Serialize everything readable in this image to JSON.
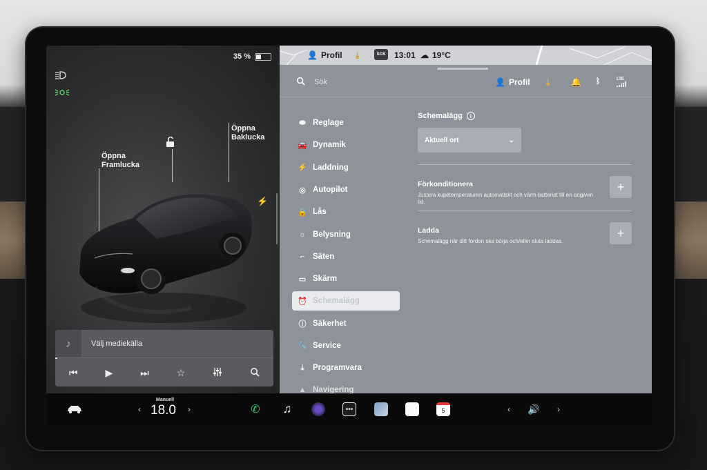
{
  "status": {
    "battery_percent": 35,
    "battery_label": "35 %"
  },
  "car": {
    "frunk_label": "Öppna\nFramlucka",
    "frunk_l1": "Öppna",
    "frunk_l2": "Framlucka",
    "trunk_l1": "Öppna",
    "trunk_l2": "Baklucka"
  },
  "media": {
    "source_label": "Välj mediekälla",
    "controls": [
      "previous-icon",
      "play-icon",
      "next-icon",
      "favorite-icon",
      "equalizer-icon",
      "search-icon"
    ]
  },
  "topbar": {
    "profile": "Profil",
    "sos": "SOS",
    "time": "13:01",
    "temperature": "19°C"
  },
  "search": {
    "placeholder": "Sök",
    "profile": "Profil",
    "signal": "LTE"
  },
  "menu": {
    "items": [
      {
        "label": "Reglage",
        "icon": "toggle-icon"
      },
      {
        "label": "Dynamik",
        "icon": "car-icon"
      },
      {
        "label": "Laddning",
        "icon": "bolt-icon"
      },
      {
        "label": "Autopilot",
        "icon": "steering-wheel-icon"
      },
      {
        "label": "Lås",
        "icon": "lock-icon"
      },
      {
        "label": "Belysning",
        "icon": "sun-icon"
      },
      {
        "label": "Säten",
        "icon": "seat-icon"
      },
      {
        "label": "Skärm",
        "icon": "display-icon"
      },
      {
        "label": "Schemalägg",
        "icon": "alarm-clock-icon",
        "active": true
      },
      {
        "label": "Säkerhet",
        "icon": "alert-circle-icon"
      },
      {
        "label": "Service",
        "icon": "wrench-icon"
      },
      {
        "label": "Programvara",
        "icon": "download-icon"
      },
      {
        "label": "Navigering",
        "icon": "navigation-icon"
      }
    ]
  },
  "content": {
    "schedule_title": "Schemalägg",
    "schedule_select": "Aktuell ort",
    "precondition_title": "Förkonditionera",
    "precondition_desc": "Justera kupétemperaturen automatiskt och värm batteriet till en angiven tid.",
    "charge_title": "Ladda",
    "charge_desc": "Schemalägg när ditt fordon ska börja och/eller sluta laddas."
  },
  "taskbar": {
    "climate_mode": "Manuell",
    "temperature": "18.0",
    "calendar_day": "5"
  },
  "colors": {
    "panel": "#8e939b",
    "active_menu_bg": "#e9ebee",
    "headlight_green": "#5ad06b",
    "phone_green": "#3ccf6a"
  }
}
